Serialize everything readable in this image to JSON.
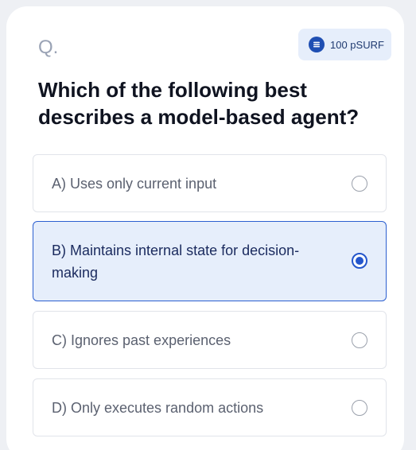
{
  "question": {
    "label": "Q.",
    "reward": "100 pSURF",
    "reward_icon": "coin-icon",
    "text": "Which of the following best describes a model-based agent?"
  },
  "options": [
    {
      "text": "A) Uses only current input",
      "selected": false
    },
    {
      "text": "B) Maintains internal state for decision-making",
      "selected": true
    },
    {
      "text": "C) Ignores past experiences",
      "selected": false
    },
    {
      "text": "D) Only executes random actions",
      "selected": false
    }
  ],
  "colors": {
    "accent": "#2456cc",
    "selected_bg": "#e6eefb",
    "badge_bg": "#e6eefb"
  }
}
